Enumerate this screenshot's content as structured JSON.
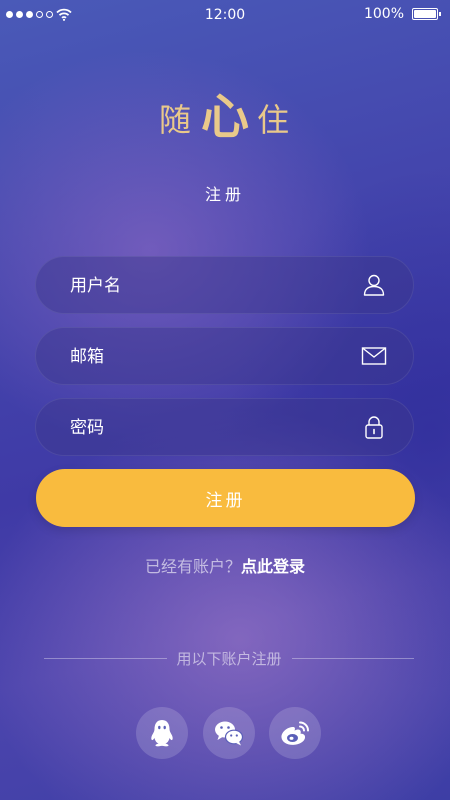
{
  "status_bar": {
    "time": "12:00",
    "battery": "100%",
    "signal_icon": "signal-dots-icon",
    "wifi_icon": "wifi-icon",
    "battery_icon": "battery-icon"
  },
  "logo": {
    "left": "随",
    "mid": "心",
    "right": "住",
    "color": "#e9c98a"
  },
  "page_title": "注册",
  "form": {
    "username": {
      "placeholder": "用户名",
      "value": "",
      "icon": "user-icon"
    },
    "email": {
      "placeholder": "邮箱",
      "value": "",
      "icon": "mail-icon"
    },
    "password": {
      "placeholder": "密码",
      "value": "",
      "icon": "lock-icon"
    },
    "submit_label": "注册",
    "submit_color": "#f9bb3e"
  },
  "login": {
    "question": "已经有账户？",
    "link": "点此登录"
  },
  "social": {
    "divider_text": "用以下账户注册",
    "providers": [
      {
        "icon": "qq-icon"
      },
      {
        "icon": "wechat-icon"
      },
      {
        "icon": "weibo-icon"
      }
    ]
  },
  "colors": {
    "background_primary": "#4446ad",
    "accent": "#f9bb3e"
  }
}
